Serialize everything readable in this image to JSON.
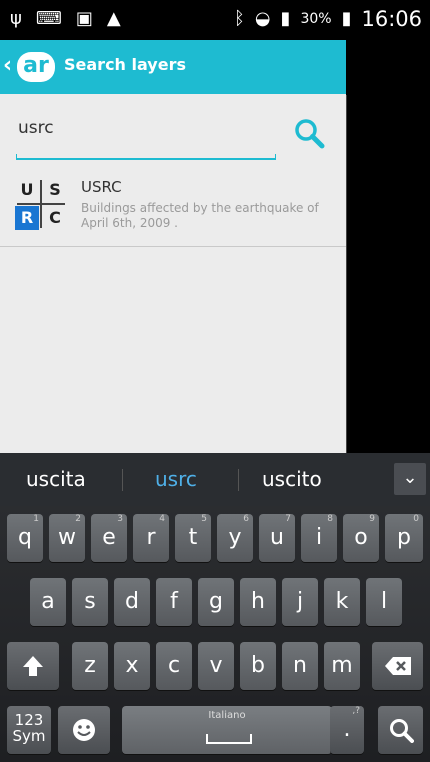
{
  "status_bar": {
    "left_icons": [
      "usb-icon",
      "keyboard-icon",
      "image-icon",
      "warning-icon"
    ],
    "right_icons": [
      "bluetooth-icon",
      "wifi-icon",
      "signal-icon",
      "battery-icon"
    ],
    "battery": "30%",
    "time": "16:06"
  },
  "app": {
    "title": "Search layers",
    "logo_text": "ar",
    "accent": "#1ebbd1"
  },
  "search": {
    "value": "usrc",
    "placeholder": ""
  },
  "results": [
    {
      "logo": [
        "U",
        "S",
        "R",
        "C"
      ],
      "title": "USRC",
      "description": "Buildings affected by the earthquake of April 6th, 2009 ."
    }
  ],
  "suggestions": [
    "uscita",
    "usrc",
    "uscito"
  ],
  "keyboard": {
    "row1": [
      {
        "k": "q",
        "h": "1"
      },
      {
        "k": "w",
        "h": "2"
      },
      {
        "k": "e",
        "h": "3"
      },
      {
        "k": "r",
        "h": "4"
      },
      {
        "k": "t",
        "h": "5"
      },
      {
        "k": "y",
        "h": "6"
      },
      {
        "k": "u",
        "h": "7"
      },
      {
        "k": "i",
        "h": "8"
      },
      {
        "k": "o",
        "h": "9"
      },
      {
        "k": "p",
        "h": "0"
      }
    ],
    "row2": [
      "a",
      "s",
      "d",
      "f",
      "g",
      "h",
      "j",
      "k",
      "l"
    ],
    "row3": [
      "z",
      "x",
      "c",
      "v",
      "b",
      "n",
      "m"
    ],
    "sym_label": "123\nSym",
    "language": "Italiano",
    "punct": ".",
    "punct_hint": ",?"
  }
}
